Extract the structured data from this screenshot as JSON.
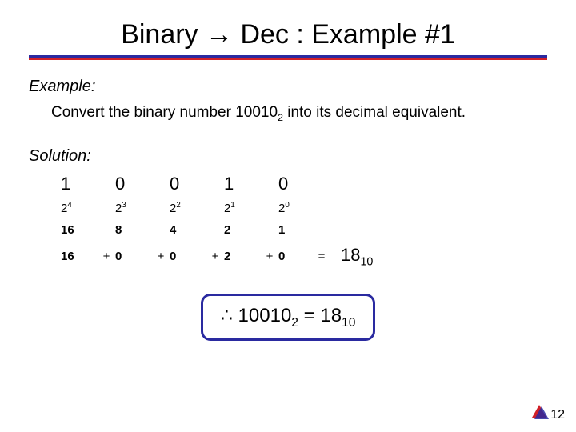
{
  "title": "Binary → Dec : Example #1",
  "example_label": "Example:",
  "example_text_a": "Convert the binary number 10010",
  "example_text_sub": "2",
  "example_text_b": " into its decimal equivalent.",
  "solution_label": "Solution:",
  "bits": [
    "1",
    "0",
    "0",
    "1",
    "0"
  ],
  "pow_base": "2",
  "pow_exp": [
    "4",
    "3",
    "2",
    "1",
    "0"
  ],
  "place_values": [
    "16",
    "8",
    "4",
    "2",
    "1"
  ],
  "products": [
    "16",
    "0",
    "0",
    "2",
    "0"
  ],
  "plus": "+",
  "equals": "=",
  "result_main": "18",
  "result_sub": "10",
  "conclusion_sym": "∴",
  "conclusion_binary": "10010",
  "conclusion_binary_sub": "2",
  "conclusion_eq": " = ",
  "conclusion_dec": "18",
  "conclusion_dec_sub": "10",
  "page_number": "12"
}
